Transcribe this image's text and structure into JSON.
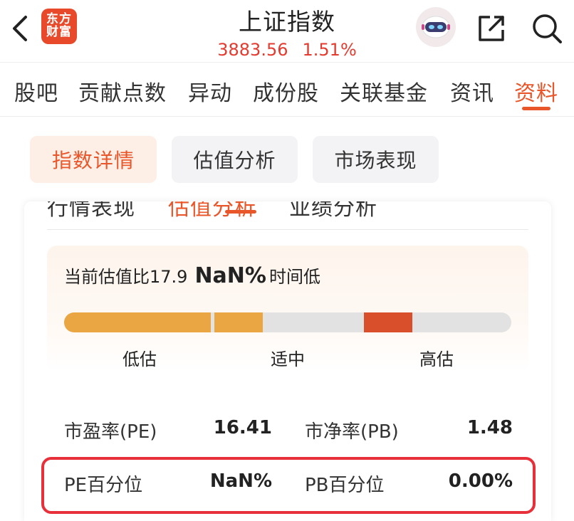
{
  "header": {
    "logo_line1": "东方",
    "logo_line2": "财富",
    "title": "上证指数",
    "price": "3883.56",
    "change_pct": "1.51%"
  },
  "tabs": [
    {
      "label": "股吧"
    },
    {
      "label": "贡献点数"
    },
    {
      "label": "异动"
    },
    {
      "label": "成份股"
    },
    {
      "label": "关联基金"
    },
    {
      "label": "资讯"
    },
    {
      "label": "资料",
      "active": true
    }
  ],
  "subtabs": [
    {
      "label": "指数详情",
      "active": true
    },
    {
      "label": "估值分析"
    },
    {
      "label": "市场表现"
    }
  ],
  "inner_tabs": [
    {
      "label": "行情表现"
    },
    {
      "label": "估值分析",
      "active": true
    },
    {
      "label": "业绩分析"
    }
  ],
  "valuation": {
    "prefix": "当前估值比17.9",
    "percent": "NaN%",
    "suffix": "时间低",
    "labels": [
      "低估",
      "适中",
      "高估"
    ]
  },
  "metrics": {
    "pe_label": "市盈率(PE)",
    "pe_value": "16.41",
    "pb_label": "市净率(PB)",
    "pb_value": "1.48",
    "pe_pct_label": "PE百分位",
    "pe_pct_value": "NaN%",
    "pb_pct_label": "PB百分位",
    "pb_pct_value": "0.00%"
  },
  "colors": {
    "accent": "#e8562a",
    "low": "#eba644",
    "high": "#d94f2b",
    "red": "#e33b2f",
    "highlight_border": "#e8303a"
  },
  "icons": [
    "back-arrow-icon",
    "robot-avatar-icon",
    "share-icon",
    "search-icon"
  ]
}
